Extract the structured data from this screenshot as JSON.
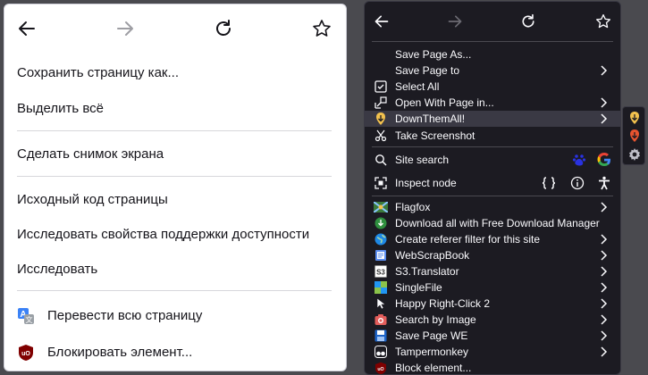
{
  "light_menu": {
    "items": [
      {
        "label": "Сохранить страницу как..."
      },
      {
        "label": "Выделить всё"
      },
      {
        "label": "Сделать снимок экрана"
      },
      {
        "label": "Исходный код страницы"
      },
      {
        "label": "Исследовать свойства поддержки доступности"
      },
      {
        "label": "Исследовать"
      },
      {
        "label": "Перевести всю страницу",
        "icon": "translate-icon"
      },
      {
        "label": "Блокировать элемент...",
        "icon": "ublock-origin-icon"
      }
    ]
  },
  "dark_menu": {
    "items": [
      {
        "label": "Save Page As..."
      },
      {
        "label": "Save Page to",
        "submenu": true
      },
      {
        "label": "Select All",
        "icon": "select-all-icon"
      },
      {
        "label": "Open With Page in...",
        "icon": "open-with-icon",
        "submenu": true
      },
      {
        "label": "DownThemAll!",
        "icon": "downthemall-icon",
        "submenu": true
      },
      {
        "label": "Take Screenshot",
        "icon": "screenshot-icon"
      },
      {
        "label": "Site search",
        "icon": "search-icon"
      },
      {
        "label": "Inspect node",
        "icon": "inspect-icon"
      },
      {
        "label": "Flagfox",
        "icon": "flagfox-icon",
        "submenu": true
      },
      {
        "label": "Download all with Free Download Manager",
        "icon": "fdm-icon"
      },
      {
        "label": "Create referer filter for this site",
        "icon": "globe-icon",
        "submenu": true
      },
      {
        "label": "WebScrapBook",
        "icon": "webscrapbook-icon",
        "submenu": true
      },
      {
        "label": "S3.Translator",
        "icon": "s3-translator-icon",
        "submenu": true
      },
      {
        "label": "SingleFile",
        "icon": "singlefile-icon",
        "submenu": true
      },
      {
        "label": "Happy Right-Click 2",
        "icon": "happy-right-click-icon",
        "submenu": true
      },
      {
        "label": "Search by Image",
        "icon": "camera-icon",
        "submenu": true
      },
      {
        "label": "Save Page WE",
        "icon": "save-page-we-icon",
        "submenu": true
      },
      {
        "label": "Tampermonkey",
        "icon": "tampermonkey-icon",
        "submenu": true
      },
      {
        "label": "Block element...",
        "icon": "ublock-origin-icon"
      }
    ]
  },
  "colors": {
    "light_bg": "#ffffff",
    "dark_bg": "#1c1b22",
    "highlight": "#3a3944"
  }
}
